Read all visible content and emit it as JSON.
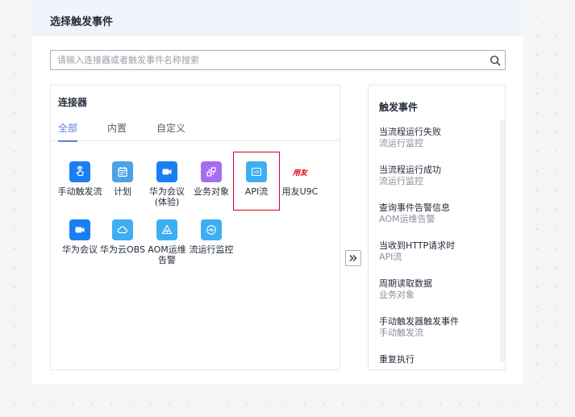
{
  "dialog": {
    "title": "选择触发事件"
  },
  "search": {
    "placeholder": "请输入连接器或者触发事件名称搜索",
    "icon": "search-icon"
  },
  "connectors": {
    "title": "连接器",
    "tabs": [
      {
        "label": "全部",
        "active": true
      },
      {
        "label": "内置",
        "active": false
      },
      {
        "label": "自定义",
        "active": false
      }
    ],
    "items": [
      {
        "label": "手动触发流",
        "icon": "hand-tap-icon",
        "color": "#1a7ff2"
      },
      {
        "label": "计划",
        "icon": "calendar-icon",
        "color": "#4ba2e6"
      },
      {
        "label": "华为会议(体验)",
        "icon": "video-camera-icon",
        "color": "#1a7ff2"
      },
      {
        "label": "业务对象",
        "icon": "object-cubes-icon",
        "color": "#a66cf2"
      },
      {
        "label": "API流",
        "icon": "api-icon",
        "color": "#3daef2",
        "selected": true
      },
      {
        "label": "用友U9C",
        "icon": "yonyou-logo-icon",
        "color": "#e60012",
        "logo_text": "用友"
      },
      {
        "label": "华为会议",
        "icon": "video-camera-icon",
        "color": "#1a7ff2"
      },
      {
        "label": "华为云OBS",
        "icon": "cloud-storage-icon",
        "color": "#3daef2"
      },
      {
        "label": "AOM运维告警",
        "icon": "monitor-wave-icon",
        "color": "#3daef2"
      },
      {
        "label": "流运行监控",
        "icon": "flow-monitor-icon",
        "color": "#3daef2"
      }
    ]
  },
  "transfer_button": {
    "icon": "double-chevron-right-icon"
  },
  "events": {
    "title": "触发事件",
    "items": [
      {
        "title": "当流程运行失败",
        "source": "流运行监控"
      },
      {
        "title": "当流程运行成功",
        "source": "流运行监控"
      },
      {
        "title": "查询事件告警信息",
        "source": "AOM运维告警"
      },
      {
        "title": "当收到HTTP请求时",
        "source": "API流"
      },
      {
        "title": "周期读取数据",
        "source": "业务对象"
      },
      {
        "title": "手动触发器触发事件",
        "source": "手动触发流"
      },
      {
        "title": "重复执行",
        "source": ""
      }
    ]
  },
  "colors": {
    "accent": "#5e7ce0",
    "selection_border": "#d9001b",
    "header_bg": "#f2f4fc"
  }
}
